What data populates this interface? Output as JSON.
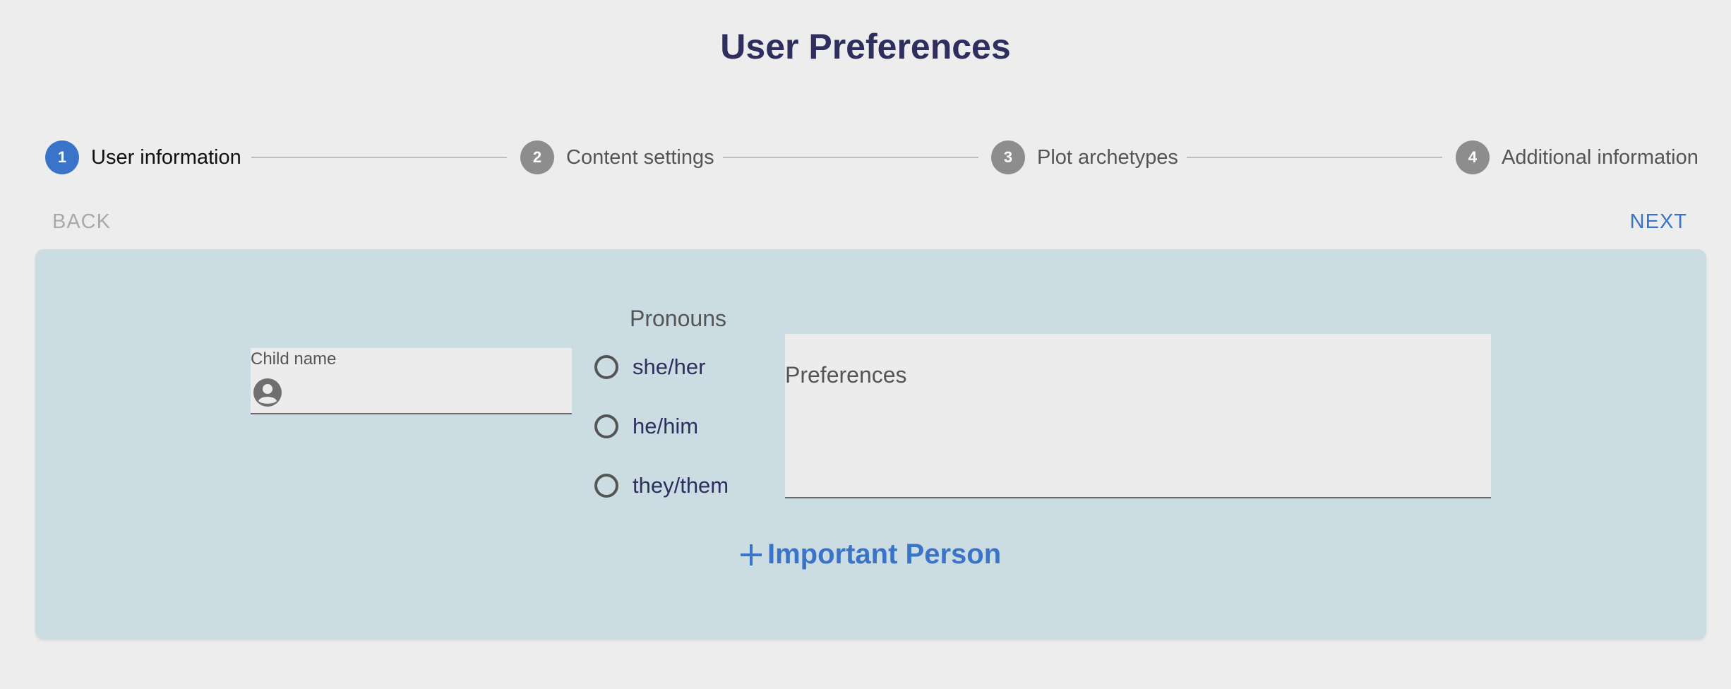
{
  "page": {
    "title": "User Preferences"
  },
  "stepper": {
    "active_step": 1,
    "steps": [
      {
        "number": "1",
        "label": "User information"
      },
      {
        "number": "2",
        "label": "Content settings"
      },
      {
        "number": "3",
        "label": "Plot archetypes"
      },
      {
        "number": "4",
        "label": "Additional information"
      }
    ]
  },
  "nav": {
    "back_label": "BACK",
    "next_label": "NEXT"
  },
  "form": {
    "child_name": {
      "label": "Child name",
      "value": "",
      "icon": "account-circle-icon"
    },
    "pronouns": {
      "label": "Pronouns",
      "options": [
        "she/her",
        "he/him",
        "they/them"
      ],
      "selected": null
    },
    "preferences": {
      "placeholder": "Preferences",
      "value": ""
    },
    "add_person": {
      "icon": "plus-icon",
      "label": "Important Person"
    }
  },
  "colors": {
    "background": "#ededed",
    "panel": "#cbdde2",
    "accent": "#3a74c9",
    "title": "#2e2f5e",
    "inactive_step": "#8d8d8d",
    "disabled_text": "#a9a9a9"
  }
}
